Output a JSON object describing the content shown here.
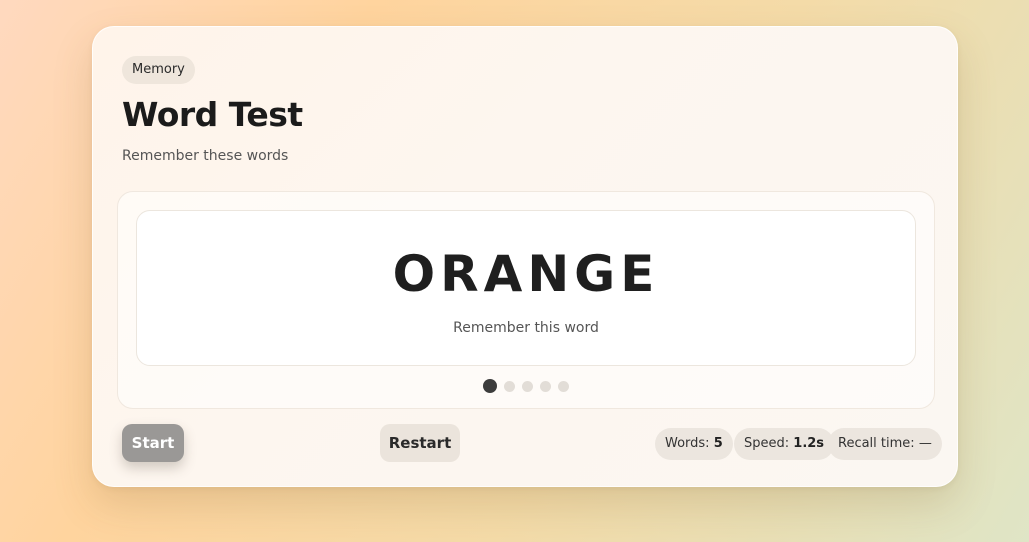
{
  "header": {
    "tag": "Memory",
    "title": "Word Test",
    "subtitle": "Remember these words"
  },
  "stage": {
    "current_word": "ORANGE",
    "hint": "Remember this word",
    "progress": {
      "current": 1,
      "total": 5
    }
  },
  "controls": {
    "start_label": "Start",
    "restart_label": "Restart"
  },
  "stats": {
    "words_label": "Words:",
    "words_value": "5",
    "speed_label": "Speed:",
    "speed_value": "1.2s",
    "recall_label": "Recall time:",
    "recall_value": "—"
  }
}
